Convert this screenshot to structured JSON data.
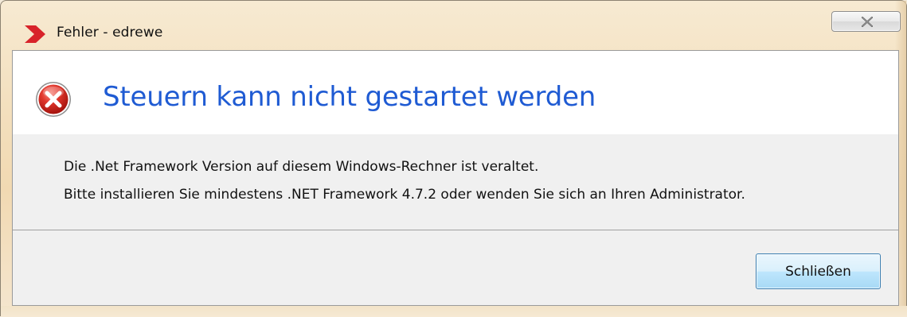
{
  "window": {
    "title": "Fehler - edrewe",
    "close_icon": "close-x-icon",
    "app_icon": "edrewe-red-arrow-logo"
  },
  "dialog": {
    "icon": "error-icon",
    "main_instruction": "Steuern kann nicht gestartet werden",
    "content_lines": [
      "Die .Net Framework Version auf diesem Windows-Rechner ist veraltet.",
      "Bitte installieren Sie mindestens .NET Framework 4.7.2 oder wenden Sie sich an Ihren Administrator."
    ],
    "close_button_label": "Schließen"
  },
  "colors": {
    "instruction_text": "#1f5bd3",
    "error_red": "#d42b22",
    "logo_red": "#d8232a",
    "button_border": "#3c7fb1"
  }
}
